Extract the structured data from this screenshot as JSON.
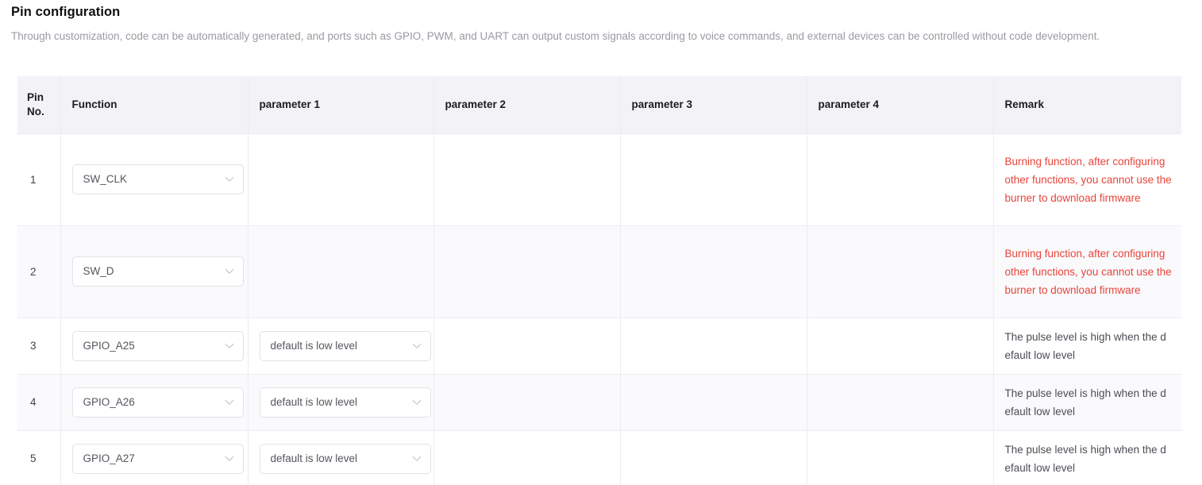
{
  "page": {
    "title": "Pin configuration",
    "description": "Through customization, code can be automatically generated, and ports such as GPIO, PWM, and UART can output custom signals according to voice commands, and external devices can be controlled without code development."
  },
  "colors": {
    "warning_text": "#e8443a",
    "header_bg": "#f2f2f7",
    "stripe_bg": "#fafafc",
    "body_text": "#4c4c55",
    "muted_text": "#9a9aa2"
  },
  "table": {
    "columns": [
      {
        "key": "pin_no",
        "label": "Pin No."
      },
      {
        "key": "function",
        "label": "Function"
      },
      {
        "key": "parameter_1",
        "label": "parameter 1"
      },
      {
        "key": "parameter_2",
        "label": "parameter 2"
      },
      {
        "key": "parameter_3",
        "label": "parameter 3"
      },
      {
        "key": "parameter_4",
        "label": "parameter 4"
      },
      {
        "key": "remark",
        "label": "Remark"
      }
    ],
    "rows": [
      {
        "pin_no": "1",
        "function": "SW_CLK",
        "parameter_1": "",
        "parameter_2": "",
        "parameter_3": "",
        "parameter_4": "",
        "remark": "Burning function, after configuring other functions, you cannot use the burner to download firmware",
        "remark_style": "warn"
      },
      {
        "pin_no": "2",
        "function": "SW_D",
        "parameter_1": "",
        "parameter_2": "",
        "parameter_3": "",
        "parameter_4": "",
        "remark": "Burning function, after configuring other functions, you cannot use the burner to download firmware",
        "remark_style": "warn"
      },
      {
        "pin_no": "3",
        "function": "GPIO_A25",
        "parameter_1": "default is low level",
        "parameter_2": "",
        "parameter_3": "",
        "parameter_4": "",
        "remark": "The pulse level is high when the default low level",
        "remark_style": "plain"
      },
      {
        "pin_no": "4",
        "function": "GPIO_A26",
        "parameter_1": "default is low level",
        "parameter_2": "",
        "parameter_3": "",
        "parameter_4": "",
        "remark": "The pulse level is high when the default low level",
        "remark_style": "plain"
      },
      {
        "pin_no": "5",
        "function": "GPIO_A27",
        "parameter_1": "default is low level",
        "parameter_2": "",
        "parameter_3": "",
        "parameter_4": "",
        "remark": "The pulse level is high when the default low level",
        "remark_style": "plain"
      }
    ]
  },
  "icons": {
    "dropdown": "chevron-down-icon"
  }
}
